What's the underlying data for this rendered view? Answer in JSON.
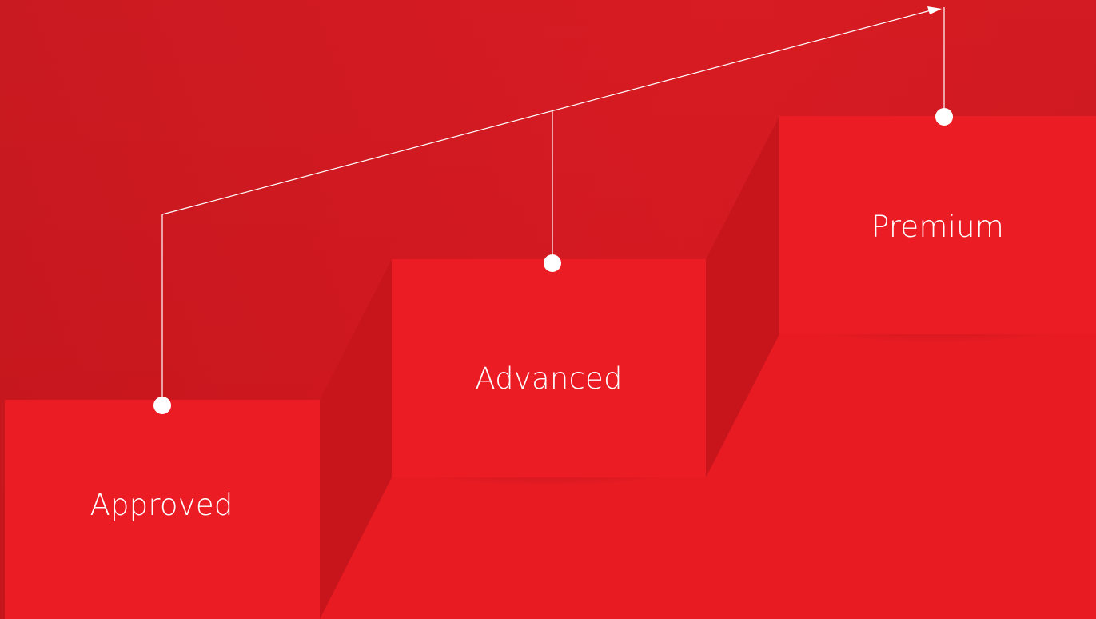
{
  "steps": [
    {
      "label": "Approved"
    },
    {
      "label": "Advanced"
    },
    {
      "label": "Premium"
    }
  ],
  "colors": {
    "background": "#d2161e",
    "step_face": "#ec1c24",
    "step_side": "#c2141b",
    "connector": "#ffffff"
  }
}
